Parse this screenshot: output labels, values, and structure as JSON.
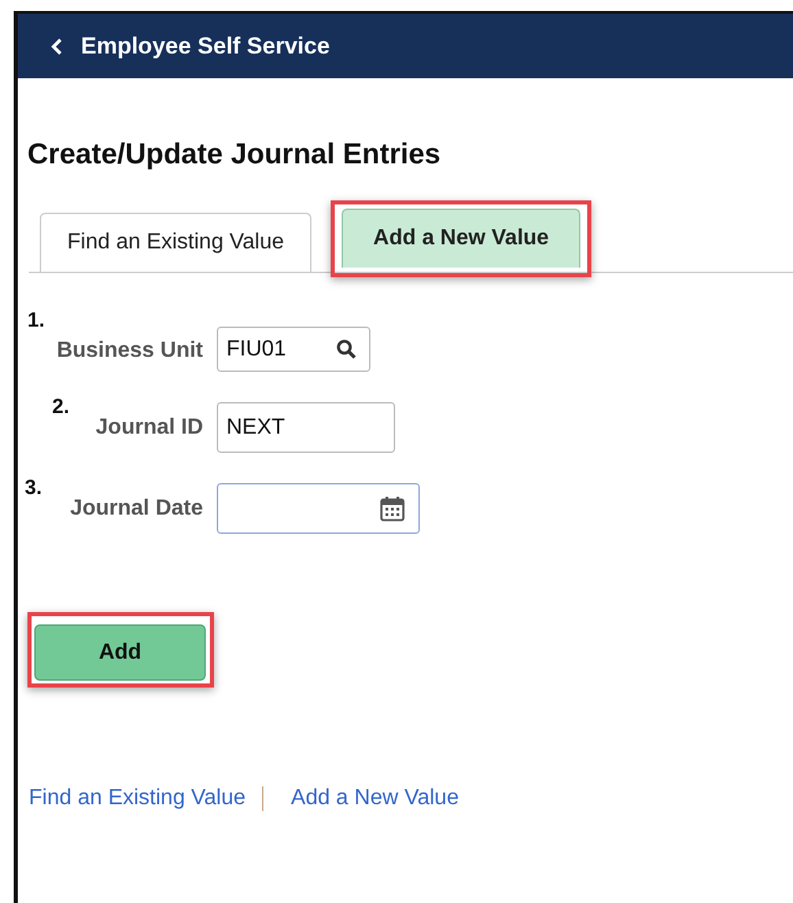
{
  "header": {
    "back_label": "Employee Self Service"
  },
  "page_title": "Create/Update Journal Entries",
  "tabs": [
    {
      "label": "Find an Existing Value",
      "selected": false,
      "highlighted": false
    },
    {
      "label": "Add a New Value",
      "selected": true,
      "highlighted": true
    }
  ],
  "fields": [
    {
      "step": "1.",
      "label": "Business Unit",
      "value": "FIU01",
      "kind": "lookup"
    },
    {
      "step": "2.",
      "label": "Journal ID",
      "value": "NEXT",
      "kind": "text"
    },
    {
      "step": "3.",
      "label": "Journal Date",
      "kind": "date"
    }
  ],
  "add_button": {
    "label": "Add",
    "highlighted": true
  },
  "footer_links": [
    "Find an Existing Value",
    "Add a New Value"
  ]
}
